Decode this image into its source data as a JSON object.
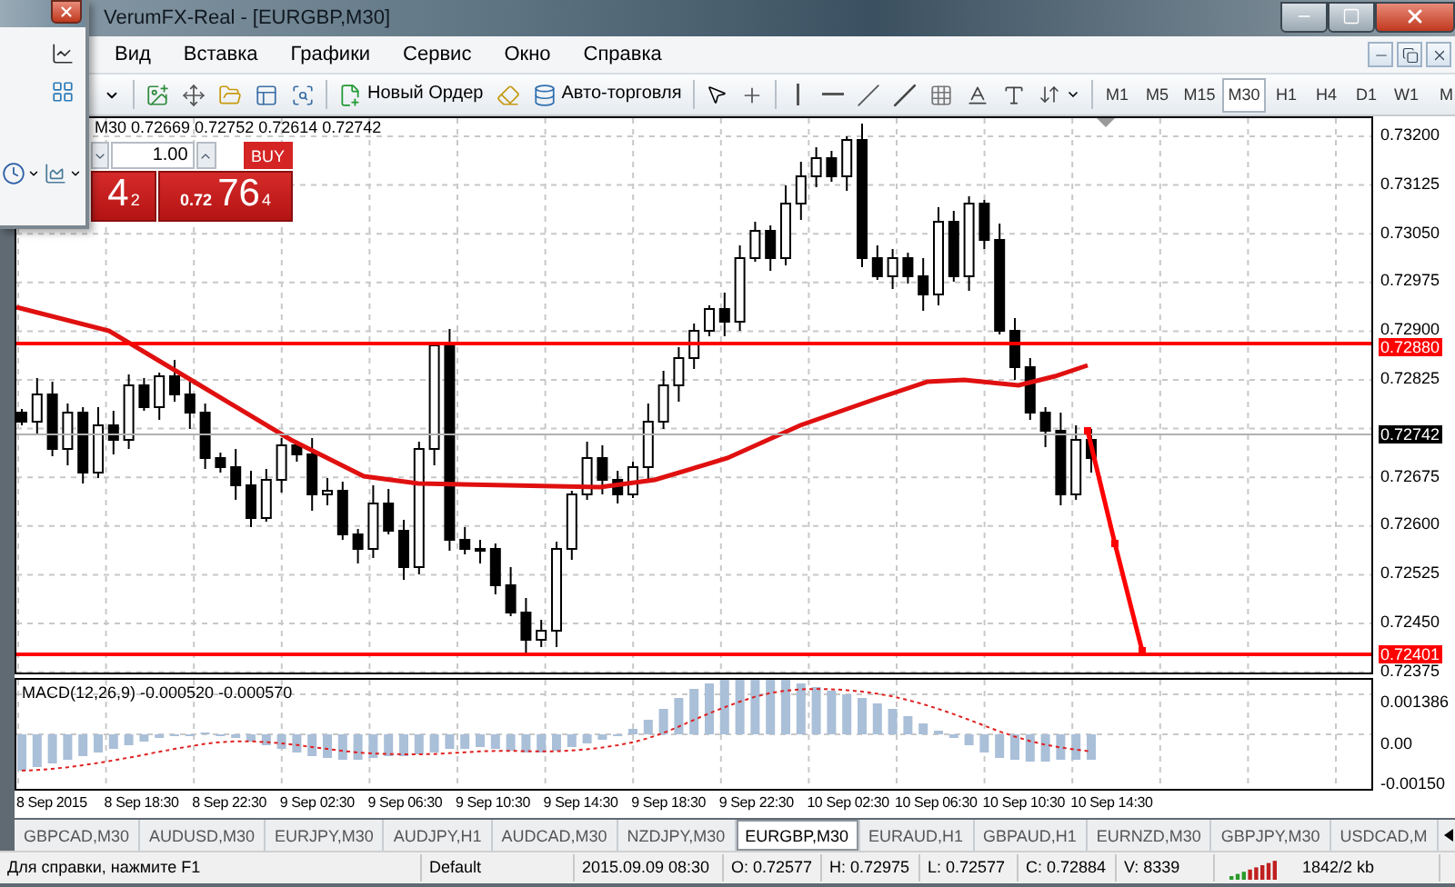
{
  "window": {
    "title": "VerumFX-Real - [EURGBP,M30]"
  },
  "menu": [
    "Вид",
    "Вставка",
    "Графики",
    "Сервис",
    "Окно",
    "Справка"
  ],
  "toolbar": {
    "new_order": "Новый Ордер",
    "auto_trading": "Авто-торговля",
    "timeframes": [
      {
        "label": "M1",
        "selected": false
      },
      {
        "label": "M5",
        "selected": false
      },
      {
        "label": "M15",
        "selected": false
      },
      {
        "label": "M30",
        "selected": true
      },
      {
        "label": "H1",
        "selected": false
      },
      {
        "label": "H4",
        "selected": false
      },
      {
        "label": "D1",
        "selected": false
      },
      {
        "label": "W1",
        "selected": false
      },
      {
        "label": "M",
        "selected": false
      }
    ]
  },
  "chart": {
    "info": "M30 0.72669 0.72752 0.72614 0.72742",
    "trade_panel": {
      "sell_price": "4",
      "sell_pips": "2",
      "lot": "1.00",
      "buy_label": "BUY",
      "buy_prefix": "0.72",
      "buy_price": "76",
      "buy_pips": "4"
    },
    "price_axis": [
      "0.73200",
      "0.73125",
      "0.73050",
      "0.72975",
      "0.72900",
      "0.72825",
      "0.72675",
      "0.72600",
      "0.72525",
      "0.72450",
      "0.72375"
    ],
    "price_labels": [
      {
        "text": "0.72880",
        "kind": "line"
      },
      {
        "text": "0.72742",
        "kind": "bid"
      },
      {
        "text": "0.72401",
        "kind": "line"
      }
    ],
    "indicator": {
      "label": "MACD(12,26,9) -0.000520 -0.000570",
      "axis": [
        "0.001386",
        "0.00",
        "-0.00150"
      ]
    },
    "time_axis": [
      "8 Sep 2015",
      "8 Sep 18:30",
      "8 Sep 22:30",
      "9 Sep 02:30",
      "9 Sep 06:30",
      "9 Sep 10:30",
      "9 Sep 14:30",
      "9 Sep 18:30",
      "9 Sep 22:30",
      "10 Sep 02:30",
      "10 Sep 06:30",
      "10 Sep 10:30",
      "10 Sep 14:30"
    ]
  },
  "chart_tabs": [
    {
      "label": "GBPCAD,M30",
      "selected": false
    },
    {
      "label": "AUDUSD,M30",
      "selected": false
    },
    {
      "label": "EURJPY,M30",
      "selected": false
    },
    {
      "label": "AUDJPY,H1",
      "selected": false
    },
    {
      "label": "AUDCAD,M30",
      "selected": false
    },
    {
      "label": "NZDJPY,M30",
      "selected": false
    },
    {
      "label": "EURGBP,M30",
      "selected": true
    },
    {
      "label": "EURAUD,H1",
      "selected": false
    },
    {
      "label": "GBPAUD,H1",
      "selected": false
    },
    {
      "label": "EURNZD,M30",
      "selected": false
    },
    {
      "label": "GBPJPY,M30",
      "selected": false
    },
    {
      "label": "USDCAD,M",
      "selected": false
    }
  ],
  "status_bar": {
    "help": "Для справки, нажмите F1",
    "profile": "Default",
    "datetime": "2015.09.09 08:30",
    "open": "O: 0.72577",
    "high": "H: 0.72975",
    "low": "L: 0.72577",
    "close": "C: 0.72884",
    "volume": "V: 8339",
    "traffic": "1842/2 kb"
  }
}
